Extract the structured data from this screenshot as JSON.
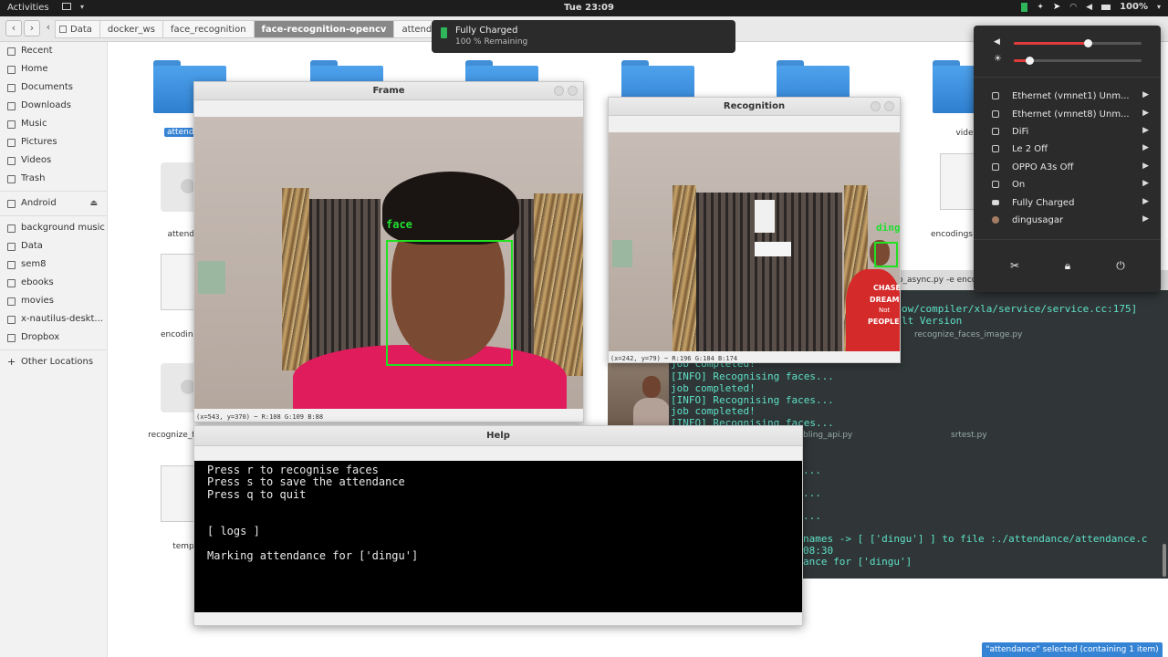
{
  "topbar": {
    "activities": "Activities",
    "clock": "Tue 23:09",
    "battery_pct": "100%"
  },
  "nav": {
    "crumbs": [
      "Data",
      "docker_ws",
      "face_recognition",
      "face-recognition-opencv",
      "attendance"
    ]
  },
  "sidebar": {
    "items": [
      "Recent",
      "Home",
      "Documents",
      "Downloads",
      "Music",
      "Pictures",
      "Videos",
      "Trash"
    ],
    "device": "Android",
    "bookmarks": [
      "background music",
      "Data",
      "sem8",
      "ebooks",
      "movies",
      "x-nautilus-deskt...",
      "Dropbox"
    ],
    "other": "Other Locations"
  },
  "files": {
    "attend_selected": "attend",
    "attend_py": "attenda",
    "encodings": "encodings",
    "recognize": "recognize_fac",
    "temp": "temp",
    "vide": "vide",
    "encodings_right": "encodings",
    "recognize_image": "recognize_faces_image.py",
    "bling": "bling_api.py",
    "srtest": "srtest.py"
  },
  "frame_window": {
    "title": "Frame",
    "bbox_label": "face",
    "status": "(x=543, y=370) ~ R:108 G:109 B:88"
  },
  "recognition_window": {
    "title": "Recognition",
    "bbox_label": "dingu",
    "status": "(x=242, y=79) ~ R:196 G:184 B:174",
    "shirt_text": [
      "CHASE",
      "DREAM",
      "Not",
      "PEOPLE"
    ]
  },
  "terminal": {
    "lines_right": [
      "o_async.py -e enco",
      "ow/compiler/xla/service/service.cc:175]",
      "lt Version"
    ],
    "lines_left": [
      "job completed!",
      "[INFO] Recognising faces...",
      "job completed!",
      "[INFO] Recognising faces...",
      "job completed!",
      "[INFO] Recognising faces..."
    ],
    "lines_bottom": [
      "...",
      "...",
      "...",
      " names -> [ ['dingu'] ] to file :./attendance/attendance.c",
      "08:30",
      "ance for ['dingu']"
    ]
  },
  "help_window": {
    "title": "Help",
    "lines": [
      "Press r to recognise faces",
      "Press s to save the attendance",
      "Press q to quit",
      "[ logs ]",
      "Marking attendance for ['dingu']"
    ]
  },
  "notification": {
    "title": "Fully Charged",
    "subtitle": "100 % Remaining"
  },
  "system_menu": {
    "volume_level": 0.58,
    "brightness_level": 0.12,
    "items": [
      {
        "label": "Ethernet (vmnet1) Unm...",
        "icon": "network-icon"
      },
      {
        "label": "Ethernet (vmnet8) Unm...",
        "icon": "network-icon"
      },
      {
        "label": "DiFi",
        "icon": "wifi-icon"
      },
      {
        "label": "Le 2 Off",
        "icon": "phone-icon"
      },
      {
        "label": "OPPO A3s Off",
        "icon": "signal-icon"
      },
      {
        "label": "On",
        "icon": "bluetooth-icon"
      },
      {
        "label": "Fully Charged",
        "icon": "battery-icon"
      },
      {
        "label": "dingusagar",
        "icon": "user-icon"
      }
    ]
  },
  "statusbar": {
    "text": "\"attendance\" selected  (containing 1 item)"
  }
}
